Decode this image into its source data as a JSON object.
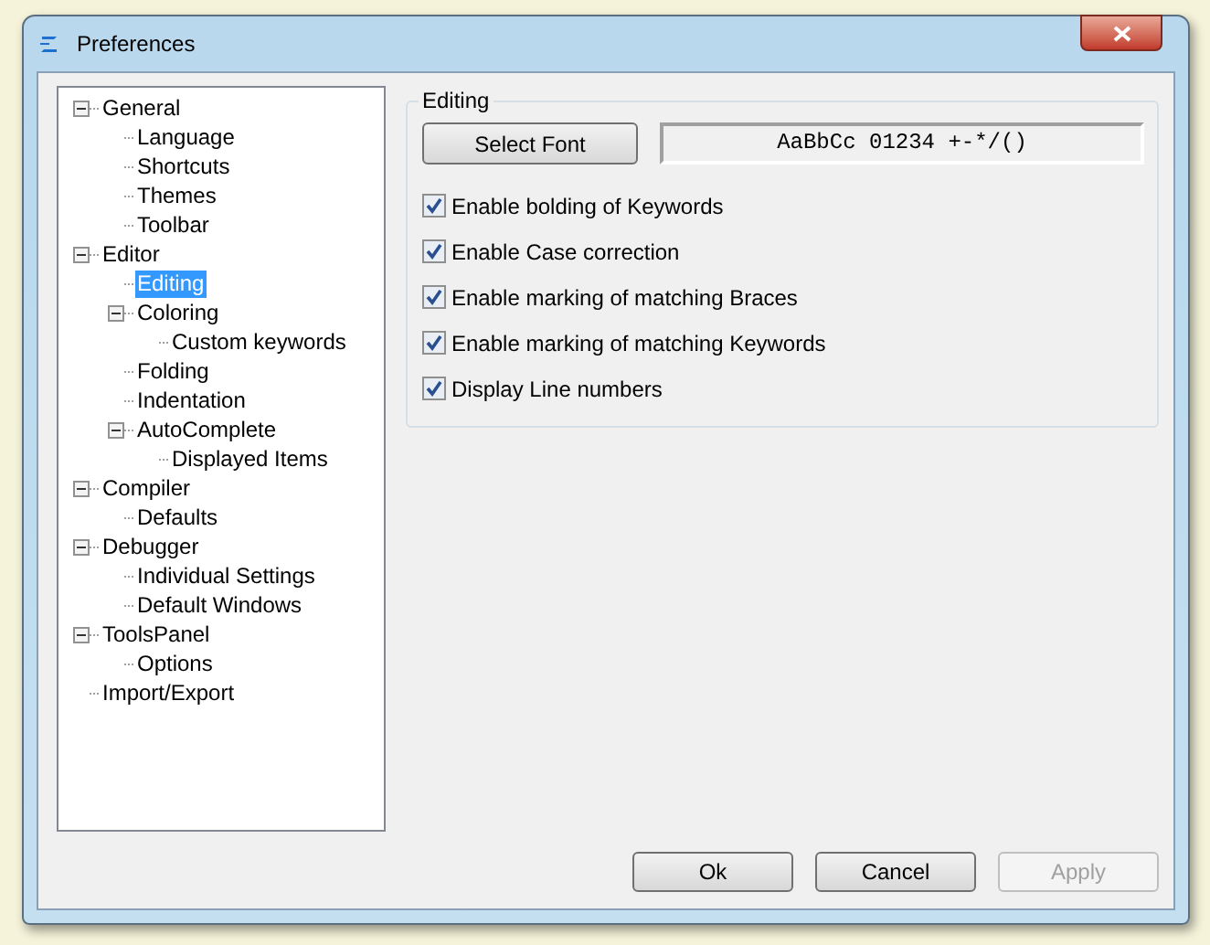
{
  "window": {
    "title": "Preferences"
  },
  "tree": [
    {
      "label": "General",
      "expanded": true,
      "selected": false,
      "children": [
        {
          "label": "Language",
          "selected": false
        },
        {
          "label": "Shortcuts",
          "selected": false
        },
        {
          "label": "Themes",
          "selected": false
        },
        {
          "label": "Toolbar",
          "selected": false
        }
      ]
    },
    {
      "label": "Editor",
      "expanded": true,
      "selected": false,
      "children": [
        {
          "label": "Editing",
          "selected": true
        },
        {
          "label": "Coloring",
          "expanded": true,
          "selected": false,
          "children": [
            {
              "label": "Custom keywords",
              "selected": false
            }
          ]
        },
        {
          "label": "Folding",
          "selected": false
        },
        {
          "label": "Indentation",
          "selected": false
        },
        {
          "label": "AutoComplete",
          "expanded": true,
          "selected": false,
          "children": [
            {
              "label": "Displayed Items",
              "selected": false
            }
          ]
        }
      ]
    },
    {
      "label": "Compiler",
      "expanded": true,
      "selected": false,
      "children": [
        {
          "label": "Defaults",
          "selected": false
        }
      ]
    },
    {
      "label": "Debugger",
      "expanded": true,
      "selected": false,
      "children": [
        {
          "label": "Individual Settings",
          "selected": false
        },
        {
          "label": "Default Windows",
          "selected": false
        }
      ]
    },
    {
      "label": "ToolsPanel",
      "expanded": true,
      "selected": false,
      "children": [
        {
          "label": "Options",
          "selected": false
        }
      ]
    },
    {
      "label": "Import/Export",
      "selected": false
    }
  ],
  "group": {
    "title": "Editing",
    "select_font_button": "Select Font",
    "font_preview": "AaBbCc 01234 +-*/()",
    "options": [
      {
        "label": "Enable bolding of Keywords",
        "checked": true
      },
      {
        "label": "Enable Case correction",
        "checked": true
      },
      {
        "label": "Enable marking of matching Braces",
        "checked": true
      },
      {
        "label": "Enable marking of matching Keywords",
        "checked": true
      },
      {
        "label": "Display Line numbers",
        "checked": true
      }
    ]
  },
  "buttons": [
    {
      "label": "Ok",
      "disabled": false
    },
    {
      "label": "Cancel",
      "disabled": false
    },
    {
      "label": "Apply",
      "disabled": true
    }
  ]
}
